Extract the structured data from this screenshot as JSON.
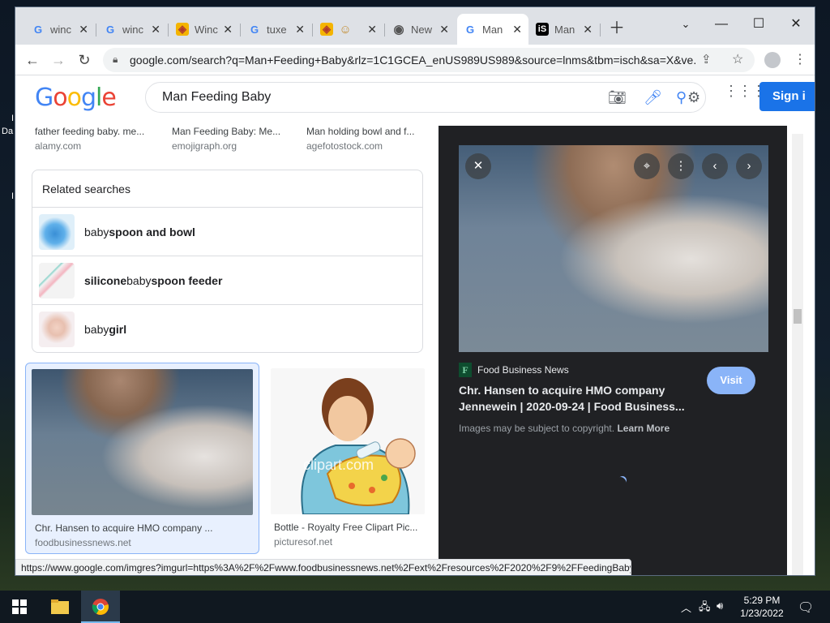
{
  "desktop": {
    "icon_labels": [
      "I",
      "Da",
      "I"
    ]
  },
  "browser": {
    "tabs": [
      {
        "favicon": "google-g",
        "title": "winc"
      },
      {
        "favicon": "google-g",
        "title": "winc"
      },
      {
        "favicon": "windows-shield",
        "title": "Winc"
      },
      {
        "favicon": "google-g",
        "title": "tuxe"
      },
      {
        "favicon": "emoji-face",
        "title": ""
      },
      {
        "favicon": "chrome-globe",
        "title": "New"
      },
      {
        "favicon": "google-g",
        "title": "Man",
        "active": true
      },
      {
        "favicon": "istock-logo",
        "title": "Man"
      }
    ],
    "url": "google.com/search?q=Man+Feeding+Baby&rlz=1C1GCEA_enUS989US989&source=lnms&tbm=isch&sa=X&ve...",
    "status_url": "https://www.google.com/imgres?imgurl=https%3A%2F%2Fwww.foodbusinessnews.net%2Fext%2Fresources%2F2020%2F9%2FFeedingBaby..."
  },
  "google": {
    "logo": "Google",
    "search_query": "Man Feeding Baby",
    "signin_label": "Sign i",
    "top_captions": [
      {
        "title": "father feeding baby. me...",
        "source": "alamy.com"
      },
      {
        "title": "Man Feeding Baby: Me...",
        "source": "emojigraph.org"
      },
      {
        "title": "Man holding bowl and f...",
        "source": "agefotostock.com"
      }
    ],
    "related": {
      "header": "Related searches",
      "items": [
        {
          "plain1": "baby ",
          "bold1": "spoon and bowl",
          "plain2": "",
          "bold2": ""
        },
        {
          "plain1": "",
          "bold1": "silicone",
          "plain2": " baby ",
          "bold2": "spoon feeder"
        },
        {
          "plain1": "baby ",
          "bold1": "girl",
          "plain2": "",
          "bold2": ""
        }
      ]
    },
    "results": [
      {
        "title": "Chr. Hansen to acquire HMO company ...",
        "source": "foodbusinessnews.net"
      },
      {
        "title": "Bottle - Royalty Free Clipart Pic...",
        "source": "picturesof.net"
      }
    ],
    "clipart_watermark": "clipart.com",
    "preview": {
      "source_name": "Food Business News",
      "source_fav_letter": "F",
      "title": "Chr. Hansen to acquire HMO company Jennewein | 2020-09-24 | Food Business...",
      "visit_label": "Visit",
      "copyright_text": "Images may be subject to copyright.",
      "learn_more": "Learn More"
    }
  },
  "taskbar": {
    "time": "5:29 PM",
    "date": "1/23/2022"
  },
  "colors": {
    "accent": "#1a73e8",
    "preview_bg": "#202124",
    "selected_card": "#e8f0fe",
    "visit_button": "#8ab4f8"
  }
}
